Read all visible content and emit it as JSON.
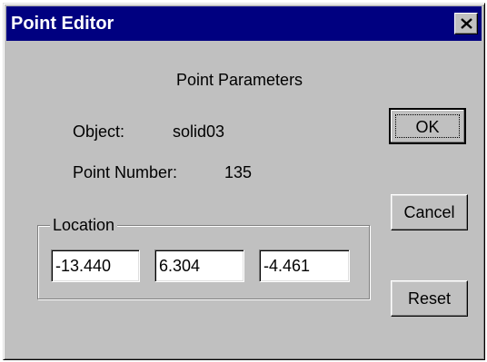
{
  "window": {
    "title": "Point Editor",
    "close_glyph": "×"
  },
  "dialog": {
    "heading": "Point Parameters",
    "object_label": "Object:",
    "object_value": "solid03",
    "point_number_label": "Point Number:",
    "point_number_value": "135"
  },
  "location": {
    "group_label": "Location",
    "x": "-13.440",
    "y": "6.304",
    "z": "-4.461"
  },
  "buttons": {
    "ok": "OK",
    "cancel": "Cancel",
    "reset": "Reset"
  },
  "icons": {
    "close": "close-icon"
  },
  "colors": {
    "titlebar": "#000080",
    "face": "#c0c0c0"
  }
}
